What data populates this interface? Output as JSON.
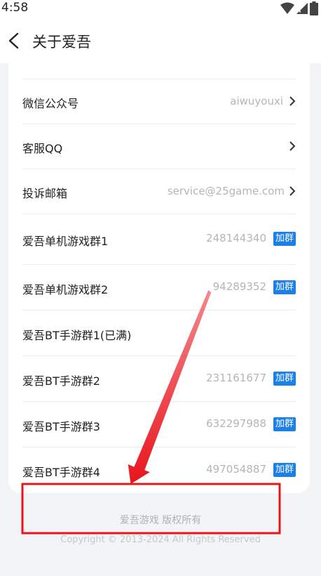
{
  "status_bar": {
    "time": "4:58",
    "icons": [
      "wifi-icon",
      "signal-icon",
      "battery-icon"
    ]
  },
  "header": {
    "title": "关于爱吾",
    "back_icon": "back-arrow-icon"
  },
  "settings": [
    {
      "label": "",
      "value": "",
      "chevron": false
    },
    {
      "label": "微信公众号",
      "value": "aiwuyouxi",
      "chevron": true
    },
    {
      "label": "客服QQ",
      "value": "",
      "chevron": true
    },
    {
      "label": "投诉邮箱",
      "value": "service@25game.com",
      "chevron": true
    }
  ],
  "groups": [
    {
      "label": "爱吾单机游戏群1",
      "value": "248144340",
      "action": "加群"
    },
    {
      "label": "爱吾单机游戏群2",
      "value": "94289352",
      "action": "加群"
    },
    {
      "label": "爱吾BT手游群1(已满)",
      "value": "",
      "action": ""
    },
    {
      "label": "爱吾BT手游群2",
      "value": "231161677",
      "action": "加群"
    },
    {
      "label": "爱吾BT手游群3",
      "value": "632297988",
      "action": "加群"
    },
    {
      "label": "爱吾BT手游群4",
      "value": "497054887",
      "action": "加群"
    }
  ],
  "footer": {
    "company": "爱吾游戏 版权所有",
    "copyright": "Copyright © 2013-2024 All Rights Reserved"
  },
  "colors": {
    "accent": "#1b7fe8",
    "annotation": "#e8141c",
    "background": "#f3f4f6"
  }
}
